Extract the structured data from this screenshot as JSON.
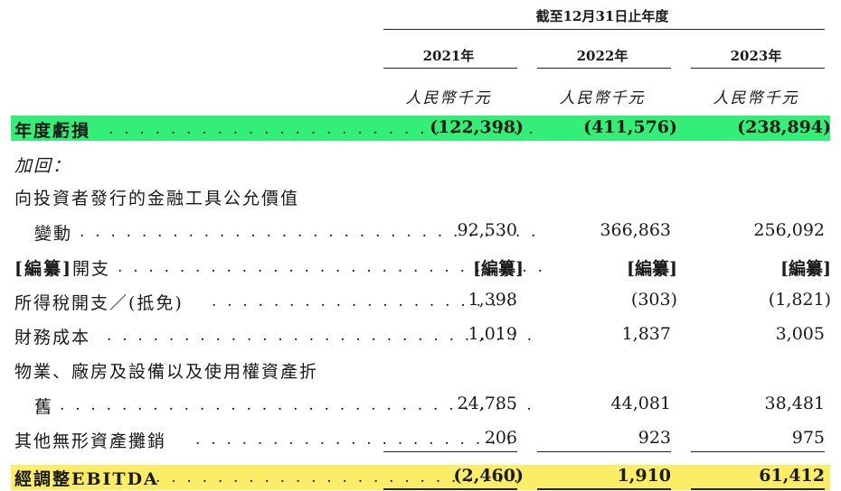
{
  "header": {
    "period": "截至12月31日止年度",
    "years": [
      "2021年",
      "2022年",
      "2023年"
    ],
    "unit": "人民幣千元"
  },
  "rows": {
    "loss": {
      "label": "年度虧損",
      "values": [
        "(122,398)",
        "(411,576)",
        "(238,894)"
      ]
    },
    "add_back": {
      "label": "加回："
    },
    "fair_value": {
      "label_line1": "向投資者發行的金融工具公允價值",
      "label_line2": "變動",
      "values": [
        "92,530",
        "366,863",
        "256,092"
      ]
    },
    "redacted": {
      "label_bracket": "[編纂]",
      "label_rest": "開支",
      "values": [
        "[編纂]",
        "[編纂]",
        "[編纂]"
      ]
    },
    "tax": {
      "label": "所得稅開支／(抵免)",
      "values": [
        "1,398",
        "(303)",
        "(1,821)"
      ]
    },
    "finance": {
      "label": "財務成本",
      "values": [
        "1,019",
        "1,837",
        "3,005"
      ]
    },
    "depreciation": {
      "label_line1": "物業、廠房及設備以及使用權資產折",
      "label_line2": "舊",
      "values": [
        "24,785",
        "44,081",
        "38,481"
      ]
    },
    "amortization": {
      "label": "其他無形資產攤銷",
      "values": [
        "206",
        "923",
        "975"
      ]
    },
    "ebitda": {
      "label": "經調整EBITDA",
      "values": [
        "(2,460)",
        "1,910",
        "61,412"
      ]
    }
  },
  "colors": {
    "loss_highlight": "#33ee77",
    "ebitda_highlight": "#fbee66"
  }
}
